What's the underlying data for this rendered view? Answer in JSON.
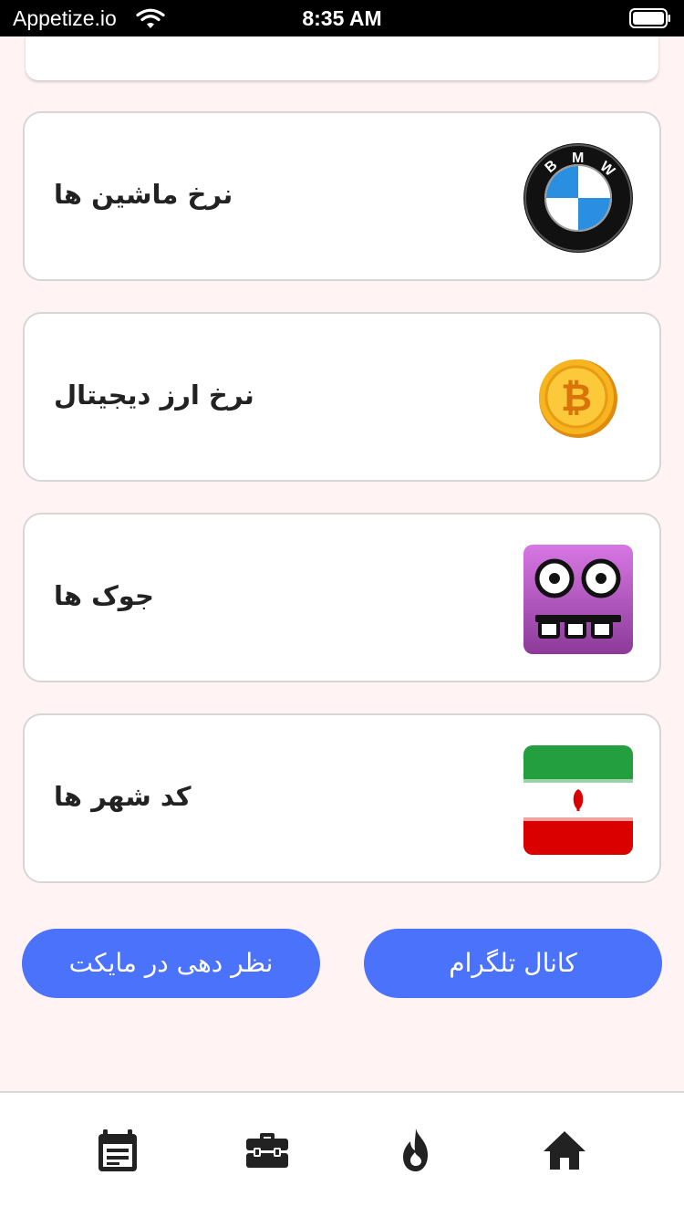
{
  "status_bar": {
    "carrier": "Appetize.io",
    "time": "8:35 AM"
  },
  "cards": [
    {
      "title": "نرخ ماشین ها",
      "icon": "bmw-logo-icon"
    },
    {
      "title": "نرخ ارز دیجیتال",
      "icon": "bitcoin-coin-icon"
    },
    {
      "title": "جوک ها",
      "icon": "funny-face-icon"
    },
    {
      "title": "کد شهر ها",
      "icon": "iran-flag-icon"
    }
  ],
  "buttons": {
    "telegram_label": "کانال تلگرام",
    "review_label": "نظر دهی در مایکت",
    "color": "#4b72fb"
  },
  "tabbar": {
    "tabs": [
      "calendar-icon",
      "briefcase-icon",
      "fire-icon",
      "home-icon"
    ]
  }
}
